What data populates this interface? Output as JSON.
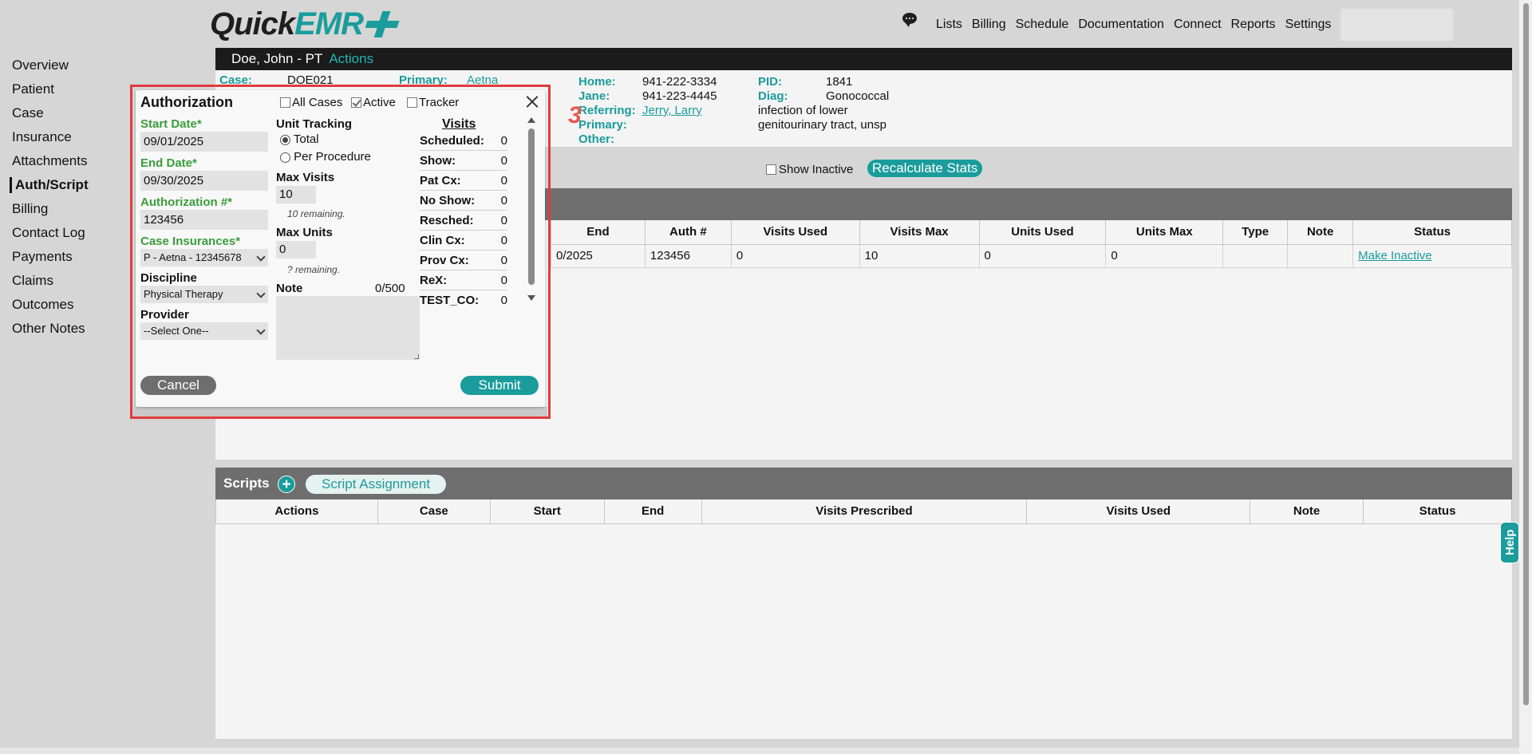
{
  "app": {
    "logo_quick": "Quick",
    "logo_emr": "EMR"
  },
  "topnav": [
    "Lists",
    "Billing",
    "Schedule",
    "Documentation",
    "Connect",
    "Reports",
    "Settings"
  ],
  "sidebar": [
    "Overview",
    "Patient",
    "Case",
    "Insurance",
    "Attachments",
    "Auth/Script",
    "Billing",
    "Contact Log",
    "Payments",
    "Claims",
    "Outcomes",
    "Other Notes"
  ],
  "patient": {
    "name": "Doe, John - PT",
    "actions": "Actions",
    "case_label": "Case:",
    "case_value": "DOE021",
    "primary_label": "Primary:",
    "primary_value": "Aetna",
    "home_label": "Home:",
    "home_value": "941-222-3334",
    "jane_label": "Jane:",
    "jane_value": "941-223-4445",
    "referring_label": "Referring:",
    "referring_value": "Jerry, Larry",
    "primary2_label": "Primary:",
    "other_label": "Other:",
    "pid_label": "PID:",
    "pid_value": "1841",
    "diag_label": "Diag:",
    "diag_line1": "Gonococcal",
    "diag_line2": "infection of lower",
    "diag_line3": "genitourinary tract, unsp"
  },
  "badge_number": "3",
  "toolbar": {
    "show_inactive": "Show Inactive",
    "recalculate": "Recalculate Stats"
  },
  "auth_table": {
    "headers": [
      "End",
      "Auth #",
      "Visits Used",
      "Visits Max",
      "Units Used",
      "Units Max",
      "Type",
      "Note",
      "Status"
    ],
    "row": [
      "0/2025",
      "123456",
      "0",
      "10",
      "0",
      "0",
      "",
      "",
      "Make Inactive"
    ]
  },
  "scripts": {
    "title": "Scripts",
    "plus": "+",
    "assign": "Script Assignment",
    "headers": [
      "Actions",
      "Case",
      "Start",
      "End",
      "Visits Prescribed",
      "Visits Used",
      "Note",
      "Status"
    ]
  },
  "help": "Help",
  "modal": {
    "title": "Authorization",
    "all_cases": "All Cases",
    "active": "Active",
    "tracker": "Tracker",
    "start_date_label": "Start Date*",
    "start_date": "09/01/2025",
    "end_date_label": "End Date*",
    "end_date": "09/30/2025",
    "auth_label": "Authorization #*",
    "auth_value": "123456",
    "case_ins_label": "Case Insurances*",
    "case_ins_value": "P - Aetna - 12345678",
    "discipline_label": "Discipline",
    "discipline_value": "Physical Therapy",
    "provider_label": "Provider",
    "provider_value": "--Select One--",
    "unit_tracking": "Unit Tracking",
    "total": "Total",
    "per_procedure": "Per Procedure",
    "max_visits_label": "Max Visits",
    "max_visits": "10",
    "visits_remaining": "10 remaining.",
    "max_units_label": "Max Units",
    "max_units": "0",
    "units_remaining": "? remaining.",
    "note_label": "Note",
    "note_count": "0/500",
    "visits_title": "Visits",
    "visits": [
      {
        "k": "Scheduled:",
        "v": "0"
      },
      {
        "k": "Show:",
        "v": "0"
      },
      {
        "k": "Pat Cx:",
        "v": "0"
      },
      {
        "k": "No Show:",
        "v": "0"
      },
      {
        "k": "Resched:",
        "v": "0"
      },
      {
        "k": "Clin Cx:",
        "v": "0"
      },
      {
        "k": "Prov Cx:",
        "v": "0"
      },
      {
        "k": "ReX:",
        "v": "0"
      },
      {
        "k": "TEST_CO:",
        "v": "0"
      }
    ],
    "cancel": "Cancel",
    "submit": "Submit"
  }
}
